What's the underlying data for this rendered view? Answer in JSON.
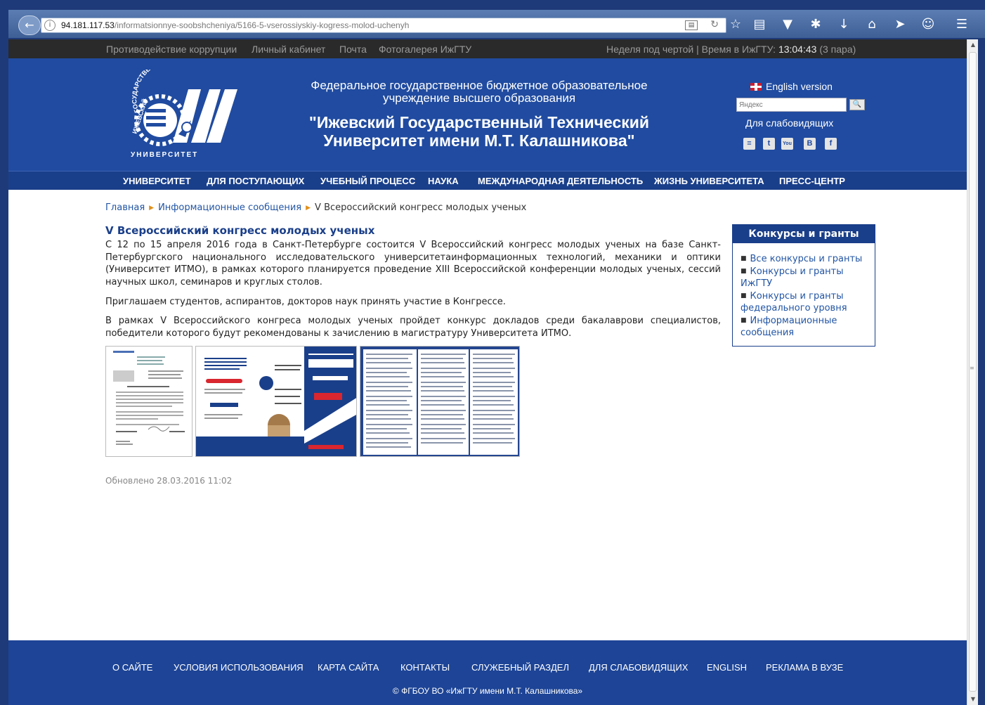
{
  "browser": {
    "url_host": "94.181.117.53",
    "url_path": "/informatsionnye-soobshcheniya/5166-5-vserossiyskiy-kogress-molod-uchenyh"
  },
  "topbar": {
    "links": [
      "Противодействие коррупции",
      "Личный кабинет",
      "Почта",
      "Фотогалерея ИжГТУ"
    ],
    "week_text": "Неделя под чертой | Время в ИжГТУ: ",
    "clock": "13:04:43",
    "period": " (3 пара)"
  },
  "header": {
    "logo_arc_text": "ГОСУДАРСТВЕННЫЙ ТЕХНИЧЕСКИЙ",
    "logo_side_text": "ИЖЕВСКИЙ",
    "logo_bottom_text": "УНИВЕРСИТЕТ",
    "inst_line1": "Федеральное государственное бюджетное образовательное",
    "inst_line2": "учреждение высшего образования",
    "name_line1": "\"Ижевский Государственный Технический",
    "name_line2": "Университет имени М.Т. Калашникова\"",
    "english_link": "English version",
    "search_placeholder": "Яндекс",
    "lowvision_link": "Для слабовидящих",
    "social": [
      "rss-icon",
      "twitter-icon",
      "youtube-icon",
      "vkontakte-icon",
      "facebook-icon"
    ],
    "social_glyphs": [
      "≡",
      "t",
      "You",
      "B",
      "f"
    ]
  },
  "nav": [
    "УНИВЕРСИТЕТ",
    "ДЛЯ ПОСТУПАЮЩИХ",
    "УЧЕБНЫЙ ПРОЦЕСС",
    "НАУКА",
    "МЕЖДУНАРОДНАЯ ДЕЯТЕЛЬНОСТЬ",
    "ЖИЗНЬ УНИВЕРСИТЕТА",
    "ПРЕСС-ЦЕНТР"
  ],
  "breadcrumb": {
    "home": "Главная",
    "section": "Информационные сообщения",
    "current": "V Всероссийский конгресс молодых ученых"
  },
  "article": {
    "title": "V Всероссийский конгресс молодых ученых",
    "para1": "С 12 по 15 апреля 2016 года в Санкт-Петербурге состоится V Всероссийский конгресс молодых ученых на базе Санкт-Петербургского национального исследовательского университетаинформационных технологий, механики и оптики (Университет ИТМО), в рамках которого планируется проведение XIII Всероссийской конференции молодых ученых, сессий научных школ, семинаров и круглых столов.",
    "para2": "Приглашаем студентов, аспирантов, докторов наук принять участие в Конгрессе.",
    "para3": "В рамках V Всероссийского конгреса молодых ученых пройдет конкурс докладов среди бакалаврови специалистов, победители которого будут рекомендованы к зачислению в магистратуру Университета ИТМО.",
    "updated": "Обновлено 28.03.2016 11:02"
  },
  "sidebar": {
    "title": "Конкурсы и гранты",
    "items": [
      "Все конкурсы и гранты",
      "Конкурсы и гранты ИжГТУ",
      "Конкурсы и гранты федерального уровня",
      "Информационные сообщения"
    ]
  },
  "footer": {
    "links": [
      "О САЙТЕ",
      "УСЛОВИЯ ИСПОЛЬЗОВАНИЯ",
      "КАРТА САЙТА",
      "КОНТАКТЫ",
      "СЛУЖЕБНЫЙ РАЗДЕЛ",
      "ДЛЯ СЛАБОВИДЯЩИХ",
      "ENGLISH",
      "РЕКЛАМА В ВУЗЕ"
    ],
    "copyright": "© ФГБОУ ВО «ИжГТУ имени М.Т. Калашникова»"
  },
  "colors": {
    "header_blue": "#204ba0",
    "nav_blue": "#1a3f8a",
    "link_blue": "#2255a4",
    "breadcrumb_arrow": "#e0901a"
  }
}
